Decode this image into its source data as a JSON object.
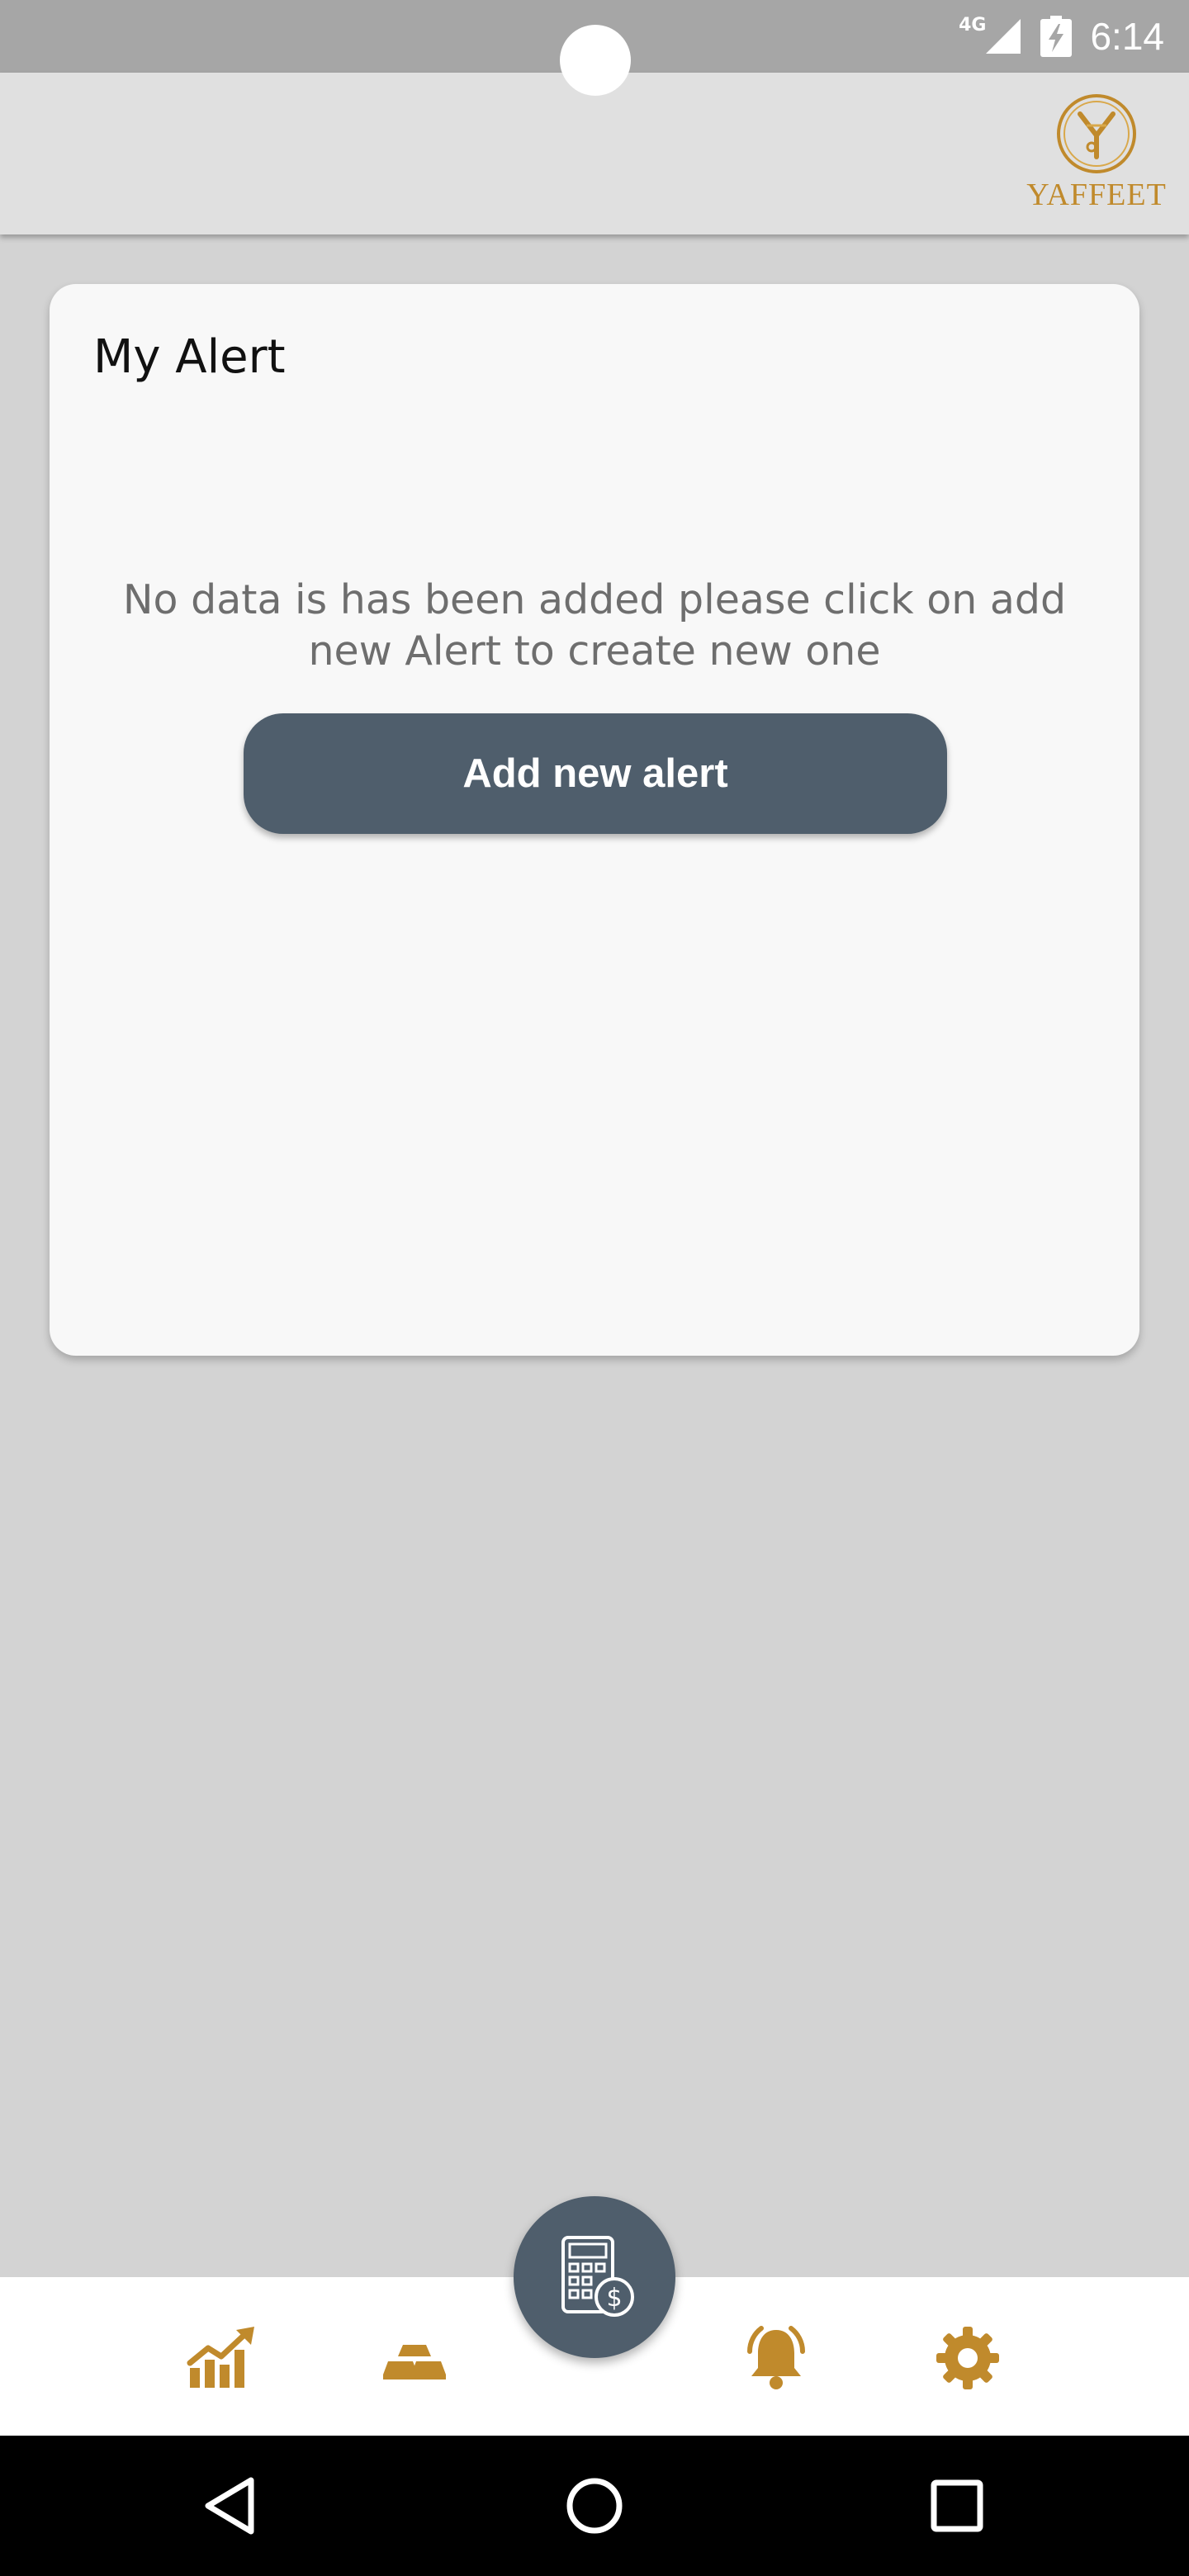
{
  "status_bar": {
    "network": "4G",
    "time": "6:14",
    "icons": [
      "signal-icon",
      "battery-charging-icon"
    ]
  },
  "app_bar": {
    "logo_text": "YAFFEET",
    "logo_icon": "yaffeet-emblem-icon"
  },
  "alert_card": {
    "title": "My Alert",
    "empty_message": "No data is has been added please click on add new Alert to create new one",
    "add_button_label": "Add new alert"
  },
  "bottom_nav": {
    "items": [
      {
        "icon": "chart-growth-icon"
      },
      {
        "icon": "gold-bars-icon"
      },
      {
        "icon": "bell-ringing-icon"
      },
      {
        "icon": "gear-icon"
      }
    ],
    "fab_icon": "calculator-dollar-icon"
  },
  "system_nav": {
    "buttons": [
      "back-icon",
      "home-icon",
      "recents-icon"
    ]
  },
  "colors": {
    "status_bar": "#a6a6a6",
    "app_bar": "#e0e0e0",
    "background": "#d3d3d3",
    "card": "#f8f8f8",
    "button": "#4f5e6c",
    "accent_gold": "#c08a2c",
    "nav_bar": "#ffffff",
    "system_nav": "#000000"
  }
}
